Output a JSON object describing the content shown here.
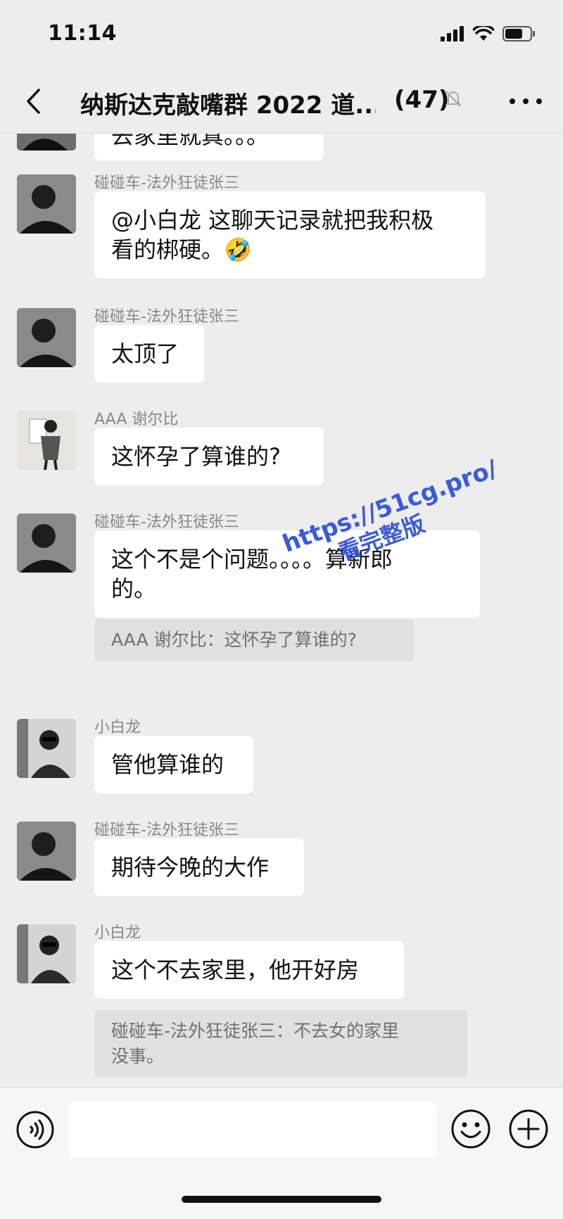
{
  "status": {
    "time": "11:14"
  },
  "header": {
    "title": "纳斯达克敲嘴群 2022 道...",
    "member_count": "(47)"
  },
  "messages": [
    {
      "sender": "",
      "text": "去家里就真。。。"
    },
    {
      "sender": "碰碰车-法外狂徒张三",
      "text_lines": [
        "@小白龙 这聊天记录就把我积极",
        "看的梆硬。🤣"
      ]
    },
    {
      "sender": "碰碰车-法外狂徒张三",
      "text": "太顶了"
    },
    {
      "sender": "AAA 谢尔比",
      "text": "这怀孕了算谁的?"
    },
    {
      "sender": "碰碰车-法外狂徒张三",
      "text_lines": [
        "这个不是个问题。。。。算新郎",
        "的。"
      ],
      "quote": "AAA 谢尔比：这怀孕了算谁的?"
    },
    {
      "sender": "小白龙",
      "text": "管他算谁的"
    },
    {
      "sender": "碰碰车-法外狂徒张三",
      "text": "期待今晚的大作"
    },
    {
      "sender": "小白龙",
      "text": "这个不去家里，他开好房",
      "quote_lines": [
        "碰碰车-法外狂徒张三：不去女的家里",
        "没事。"
      ]
    }
  ],
  "watermark": {
    "line1": "https://51cg.pro/",
    "line2": "看完整版"
  },
  "input": {
    "value": "",
    "placeholder": ""
  },
  "icons": {
    "back": "chevron-left-icon",
    "mute": "bell-slash-icon",
    "more": "more-dots-icon",
    "voice": "voice-icon",
    "emoji": "smiley-icon",
    "plus": "plus-circle-icon"
  },
  "colors": {
    "background": "#ededed",
    "bubble": "#ffffff",
    "quote": "#e0e0e0",
    "watermark": "#3b5bdb"
  }
}
